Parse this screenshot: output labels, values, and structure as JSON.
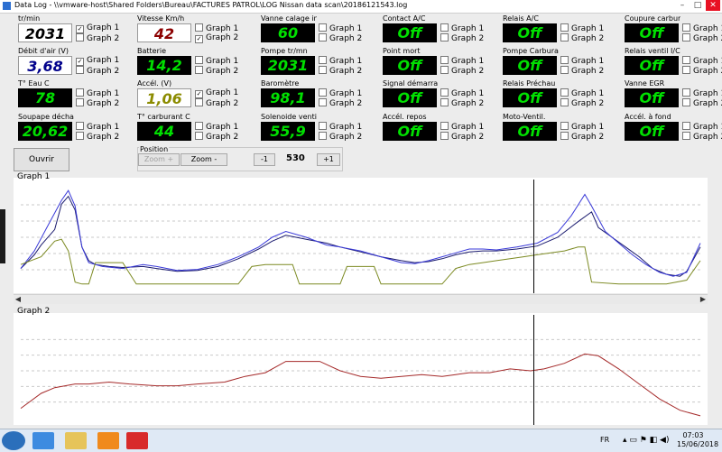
{
  "window": {
    "title": "Data Log - \\\\vmware-host\\Shared Folders\\Bureau\\FACTURES PATROL\\LOG Nissan data scan\\20186121543.log",
    "minimize": "–",
    "maximize": "□",
    "close": "✕"
  },
  "graph_options": [
    "Graph 1",
    "Graph 2"
  ],
  "sensors": [
    {
      "label": "tr/min",
      "value": "2031",
      "style": "light",
      "color": "#000000",
      "g1": true,
      "g2": false
    },
    {
      "label": "Vitesse Km/h",
      "value": "42",
      "style": "light",
      "color": "#8b0000",
      "g1": false,
      "g2": true
    },
    {
      "label": "Vanne calage in",
      "value": "60",
      "style": "dark",
      "color": "#00e000",
      "g1": false,
      "g2": false
    },
    {
      "label": "Contact A/C",
      "value": "Off",
      "style": "dark",
      "color": "#00e000",
      "g1": false,
      "g2": false
    },
    {
      "label": "Relais A/C",
      "value": "Off",
      "style": "dark",
      "color": "#00e000",
      "g1": false,
      "g2": false
    },
    {
      "label": "Coupure carbur",
      "value": "Off",
      "style": "dark",
      "color": "#00e000",
      "g1": false,
      "g2": false
    },
    {
      "label": "Débit d'air (V)",
      "value": "3,68",
      "style": "light",
      "color": "#00008b",
      "g1": true,
      "g2": false
    },
    {
      "label": "Batterie",
      "value": "14,2",
      "style": "dark",
      "color": "#00e000",
      "g1": false,
      "g2": false
    },
    {
      "label": "Pompe tr/mn",
      "value": "2031",
      "style": "dark",
      "color": "#00e000",
      "g1": false,
      "g2": false
    },
    {
      "label": "Point mort",
      "value": "Off",
      "style": "dark",
      "color": "#00e000",
      "g1": false,
      "g2": false
    },
    {
      "label": "Pompe Carbura",
      "value": "Off",
      "style": "dark",
      "color": "#00e000",
      "g1": false,
      "g2": false
    },
    {
      "label": "Relais ventil I/C",
      "value": "Off",
      "style": "dark",
      "color": "#00e000",
      "g1": false,
      "g2": false
    },
    {
      "label": "T° Eau C",
      "value": "78",
      "style": "dark",
      "color": "#00e000",
      "g1": false,
      "g2": false
    },
    {
      "label": "Accél. (V)",
      "value": "1,06",
      "style": "light",
      "color": "#8b8b00",
      "g1": true,
      "g2": false
    },
    {
      "label": "Baromètre",
      "value": "98,1",
      "style": "dark",
      "color": "#00e000",
      "g1": false,
      "g2": false
    },
    {
      "label": "Signal démarra",
      "value": "Off",
      "style": "dark",
      "color": "#00e000",
      "g1": false,
      "g2": false
    },
    {
      "label": "Relais Préchau",
      "value": "Off",
      "style": "dark",
      "color": "#00e000",
      "g1": false,
      "g2": false
    },
    {
      "label": "Vanne EGR",
      "value": "Off",
      "style": "dark",
      "color": "#00e000",
      "g1": false,
      "g2": false
    },
    {
      "label": "Soupape décha",
      "value": "20,62",
      "style": "dark",
      "color": "#00e000",
      "g1": false,
      "g2": false
    },
    {
      "label": "T° carburant C",
      "value": "44",
      "style": "dark",
      "color": "#00e000",
      "g1": false,
      "g2": false
    },
    {
      "label": "Solenoide ventil",
      "value": "55,9",
      "style": "dark",
      "color": "#00e000",
      "g1": false,
      "g2": false
    },
    {
      "label": "Accél. repos",
      "value": "Off",
      "style": "dark",
      "color": "#00e000",
      "g1": false,
      "g2": false
    },
    {
      "label": "Moto-Ventil.",
      "value": "Off",
      "style": "dark",
      "color": "#00e000",
      "g1": false,
      "g2": false
    },
    {
      "label": "Accél. à fond",
      "value": "Off",
      "style": "dark",
      "color": "#00e000",
      "g1": false,
      "g2": false
    }
  ],
  "controls": {
    "open_button": "Ouvrir",
    "position_label": "Position",
    "zoom_plus": "Zoom +",
    "zoom_minus": "Zoom -",
    "minus_one": "-1",
    "position_value": "530",
    "plus_one": "+1"
  },
  "graph1": {
    "label": "Graph 1",
    "series": [
      {
        "name": "tr/min",
        "color": "#1a1a6e",
        "points": [
          [
            0,
            0.18
          ],
          [
            2,
            0.32
          ],
          [
            3,
            0.42
          ],
          [
            5,
            0.58
          ],
          [
            6,
            0.84
          ],
          [
            7,
            0.92
          ],
          [
            8,
            0.78
          ],
          [
            9,
            0.4
          ],
          [
            10,
            0.26
          ],
          [
            11,
            0.22
          ],
          [
            13,
            0.2
          ],
          [
            15,
            0.19
          ],
          [
            18,
            0.2
          ],
          [
            20,
            0.18
          ],
          [
            23,
            0.15
          ],
          [
            26,
            0.16
          ],
          [
            29,
            0.2
          ],
          [
            32,
            0.28
          ],
          [
            35,
            0.38
          ],
          [
            37,
            0.46
          ],
          [
            39,
            0.52
          ],
          [
            42,
            0.48
          ],
          [
            45,
            0.44
          ],
          [
            47,
            0.4
          ],
          [
            50,
            0.35
          ],
          [
            53,
            0.3
          ],
          [
            56,
            0.26
          ],
          [
            58,
            0.24
          ],
          [
            60,
            0.25
          ],
          [
            62,
            0.28
          ],
          [
            64,
            0.32
          ],
          [
            66,
            0.35
          ],
          [
            68,
            0.36
          ],
          [
            70,
            0.36
          ],
          [
            73,
            0.38
          ],
          [
            76,
            0.41
          ],
          [
            79,
            0.5
          ],
          [
            82,
            0.66
          ],
          [
            84,
            0.76
          ],
          [
            85,
            0.6
          ],
          [
            87,
            0.5
          ],
          [
            89,
            0.4
          ],
          [
            91,
            0.3
          ],
          [
            93,
            0.18
          ],
          [
            95,
            0.12
          ],
          [
            97,
            0.1
          ],
          [
            98,
            0.15
          ],
          [
            100,
            0.4
          ]
        ]
      },
      {
        "name": "Débit d'air (V)",
        "color": "#3a3ad8",
        "points": [
          [
            0,
            0.18
          ],
          [
            2,
            0.36
          ],
          [
            4,
            0.62
          ],
          [
            6,
            0.88
          ],
          [
            7,
            0.98
          ],
          [
            8,
            0.82
          ],
          [
            9,
            0.4
          ],
          [
            10,
            0.24
          ],
          [
            12,
            0.2
          ],
          [
            15,
            0.18
          ],
          [
            18,
            0.22
          ],
          [
            20,
            0.2
          ],
          [
            23,
            0.16
          ],
          [
            26,
            0.17
          ],
          [
            29,
            0.22
          ],
          [
            32,
            0.3
          ],
          [
            35,
            0.4
          ],
          [
            37,
            0.5
          ],
          [
            39,
            0.56
          ],
          [
            42,
            0.5
          ],
          [
            45,
            0.42
          ],
          [
            47,
            0.4
          ],
          [
            50,
            0.36
          ],
          [
            53,
            0.3
          ],
          [
            56,
            0.24
          ],
          [
            58,
            0.23
          ],
          [
            60,
            0.26
          ],
          [
            62,
            0.3
          ],
          [
            64,
            0.34
          ],
          [
            66,
            0.38
          ],
          [
            68,
            0.38
          ],
          [
            70,
            0.37
          ],
          [
            73,
            0.4
          ],
          [
            76,
            0.44
          ],
          [
            79,
            0.55
          ],
          [
            81,
            0.72
          ],
          [
            83,
            0.94
          ],
          [
            84,
            0.82
          ],
          [
            86,
            0.56
          ],
          [
            88,
            0.44
          ],
          [
            90,
            0.32
          ],
          [
            92,
            0.22
          ],
          [
            94,
            0.14
          ],
          [
            96,
            0.1
          ],
          [
            98,
            0.14
          ],
          [
            100,
            0.44
          ]
        ]
      },
      {
        "name": "Accél. (V)",
        "color": "#7c8a22",
        "points": [
          [
            0,
            0.22
          ],
          [
            3,
            0.3
          ],
          [
            5,
            0.46
          ],
          [
            6,
            0.48
          ],
          [
            7,
            0.36
          ],
          [
            8,
            0.04
          ],
          [
            9,
            0.02
          ],
          [
            10,
            0.02
          ],
          [
            11,
            0.24
          ],
          [
            13,
            0.24
          ],
          [
            15,
            0.24
          ],
          [
            17,
            0.02
          ],
          [
            22,
            0.02
          ],
          [
            27,
            0.02
          ],
          [
            32,
            0.02
          ],
          [
            34,
            0.2
          ],
          [
            36,
            0.22
          ],
          [
            38,
            0.22
          ],
          [
            40,
            0.22
          ],
          [
            41,
            0.02
          ],
          [
            45,
            0.02
          ],
          [
            47,
            0.02
          ],
          [
            48,
            0.2
          ],
          [
            50,
            0.2
          ],
          [
            52,
            0.2
          ],
          [
            53,
            0.02
          ],
          [
            58,
            0.02
          ],
          [
            62,
            0.02
          ],
          [
            64,
            0.18
          ],
          [
            66,
            0.22
          ],
          [
            68,
            0.24
          ],
          [
            70,
            0.26
          ],
          [
            72,
            0.28
          ],
          [
            74,
            0.3
          ],
          [
            76,
            0.32
          ],
          [
            78,
            0.34
          ],
          [
            80,
            0.36
          ],
          [
            82,
            0.4
          ],
          [
            83,
            0.4
          ],
          [
            84,
            0.04
          ],
          [
            88,
            0.02
          ],
          [
            92,
            0.02
          ],
          [
            95,
            0.02
          ],
          [
            98,
            0.06
          ],
          [
            100,
            0.26
          ]
        ]
      }
    ]
  },
  "graph2": {
    "label": "Graph 2",
    "series": [
      {
        "name": "Vitesse Km/h",
        "color": "#a52a2a",
        "points": [
          [
            0,
            0.1
          ],
          [
            3,
            0.26
          ],
          [
            5,
            0.32
          ],
          [
            8,
            0.36
          ],
          [
            10,
            0.36
          ],
          [
            13,
            0.38
          ],
          [
            16,
            0.36
          ],
          [
            20,
            0.34
          ],
          [
            23,
            0.34
          ],
          [
            26,
            0.36
          ],
          [
            30,
            0.38
          ],
          [
            33,
            0.44
          ],
          [
            36,
            0.48
          ],
          [
            39,
            0.6
          ],
          [
            42,
            0.6
          ],
          [
            44,
            0.6
          ],
          [
            47,
            0.5
          ],
          [
            50,
            0.44
          ],
          [
            53,
            0.42
          ],
          [
            56,
            0.44
          ],
          [
            59,
            0.46
          ],
          [
            62,
            0.44
          ],
          [
            64,
            0.46
          ],
          [
            66,
            0.48
          ],
          [
            69,
            0.48
          ],
          [
            72,
            0.52
          ],
          [
            75,
            0.5
          ],
          [
            77,
            0.52
          ],
          [
            80,
            0.58
          ],
          [
            83,
            0.68
          ],
          [
            85,
            0.66
          ],
          [
            88,
            0.52
          ],
          [
            91,
            0.36
          ],
          [
            94,
            0.2
          ],
          [
            97,
            0.08
          ],
          [
            100,
            0.02
          ]
        ]
      }
    ]
  },
  "cursor": {
    "position": 0.755
  },
  "taskbar": {
    "lang": "FR",
    "time": "07:03",
    "date": "15/06/2018"
  }
}
